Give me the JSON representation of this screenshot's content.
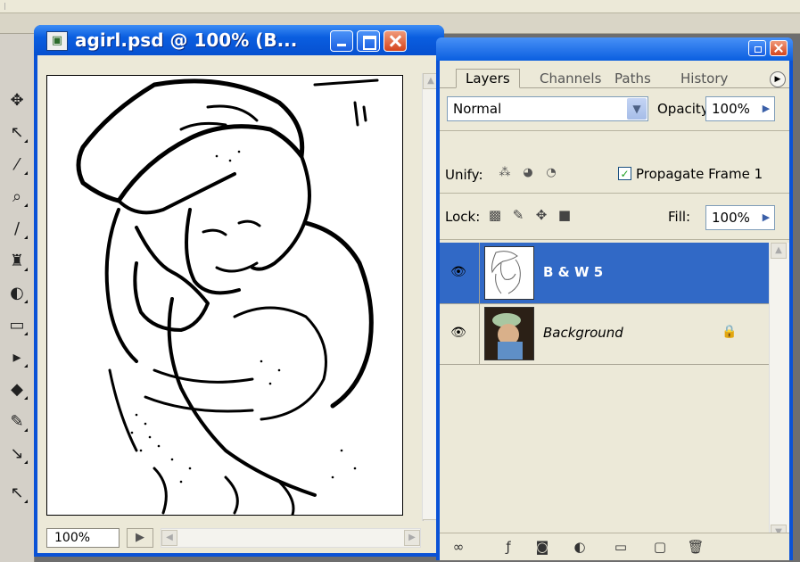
{
  "document_window": {
    "title": "agirl.psd @ 100% (B...",
    "zoom": "100%",
    "status_arrow": "▶"
  },
  "layers_panel": {
    "tabs": [
      {
        "label": "Layers",
        "active": true
      },
      {
        "label": "Channels",
        "active": false
      },
      {
        "label": "Paths",
        "active": false
      },
      {
        "label": "History",
        "active": false
      }
    ],
    "blend_mode": "Normal",
    "opacity_label": "Opacity:",
    "opacity_value": "100%",
    "unify_label": "Unify:",
    "propagate_label": "Propagate Frame 1",
    "propagate_checked": true,
    "lock_label": "Lock:",
    "fill_label": "Fill:",
    "fill_value": "100%",
    "layers": [
      {
        "name": "B & W 5",
        "selected": true,
        "visible": true,
        "locked": false
      },
      {
        "name": "Background",
        "selected": false,
        "visible": true,
        "locked": true
      }
    ],
    "bottom_icons": [
      "link-icon",
      "layer-style-icon",
      "layer-mask-icon",
      "adjustment-layer-icon",
      "new-group-icon",
      "new-layer-icon",
      "delete-layer-icon"
    ]
  },
  "colors": {
    "titlebar_blue": "#0a5ee0",
    "selected_layer": "#3169c6",
    "panel_bg": "#ece9d8",
    "close_red": "#d4451d"
  }
}
